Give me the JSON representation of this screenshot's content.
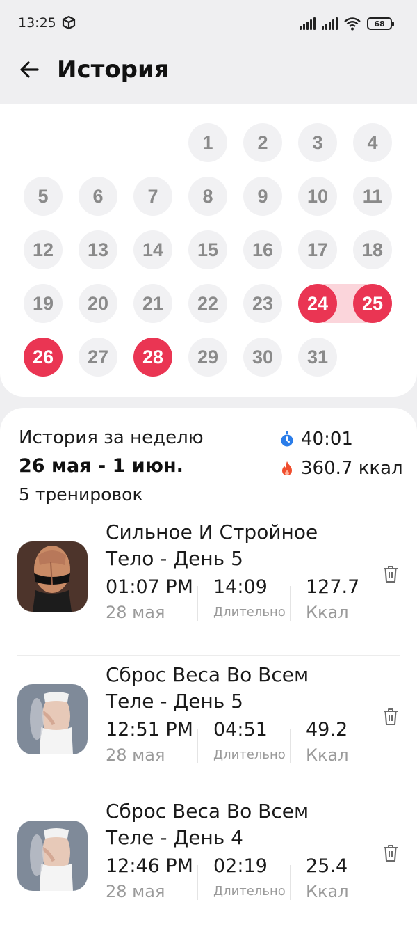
{
  "status_bar": {
    "time": "13:25",
    "battery": "68"
  },
  "header": {
    "title": "История"
  },
  "calendar": {
    "days": [
      "1",
      "2",
      "3",
      "4",
      "5",
      "6",
      "7",
      "8",
      "9",
      "10",
      "11",
      "12",
      "13",
      "14",
      "15",
      "16",
      "17",
      "18",
      "19",
      "20",
      "21",
      "22",
      "23",
      "24",
      "25",
      "26",
      "27",
      "28",
      "29",
      "30",
      "31"
    ],
    "active_days": [
      "24",
      "25",
      "26",
      "28"
    ],
    "accent_color": "#ea3553",
    "streak_color": "#fbd5db"
  },
  "summary": {
    "title": "История за неделю",
    "range": "26 мая - 1 июн.",
    "count": "5 тренировок",
    "duration": "40:01",
    "calories": "360.7 ккал"
  },
  "workouts": [
    {
      "title": "Сильное И Стройное Тело - День 5",
      "time": "01:07 PM",
      "date": "28 мая",
      "duration": "14:09",
      "duration_label": "Длительно",
      "kcal": "127.7",
      "kcal_label": "Ккал"
    },
    {
      "title": "Сброс Веса Во Всем Теле - День 5",
      "time": "12:51 PM",
      "date": "28 мая",
      "duration": "04:51",
      "duration_label": "Длительно",
      "kcal": "49.2",
      "kcal_label": "Ккал"
    },
    {
      "title": "Сброс Веса Во Всем Теле - День 4",
      "time": "12:46 PM",
      "date": "28 мая",
      "duration": "02:19",
      "duration_label": "Длительно",
      "kcal": "25.4",
      "kcal_label": "Ккал"
    }
  ]
}
